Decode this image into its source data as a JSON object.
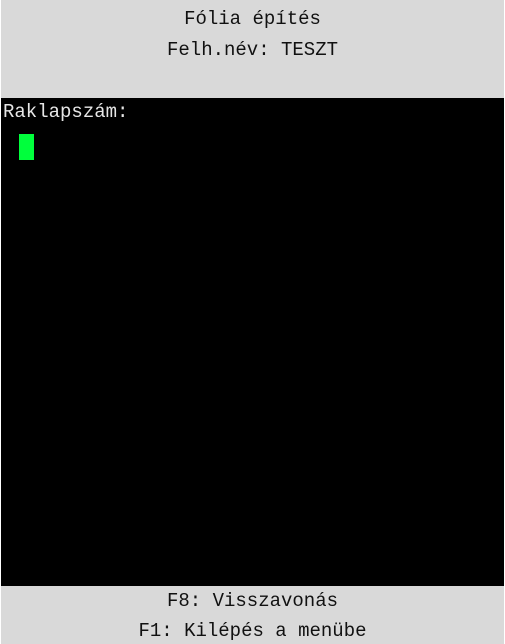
{
  "header": {
    "title": "Fólia építés",
    "user_line": "Felh.név: TESZT"
  },
  "screen": {
    "prompt_label": "Raklapszám:",
    "input_value": "",
    "cursor_color": "#00ff3c"
  },
  "footer": {
    "undo_hint": "F8: Visszavonás",
    "exit_hint": "F1: Kilépés a menübe"
  },
  "colors": {
    "screen_background": "#000000",
    "bar_background": "#d9d9d9",
    "text_on_bar": "#111111",
    "text_on_screen": "#e6e6e6"
  }
}
